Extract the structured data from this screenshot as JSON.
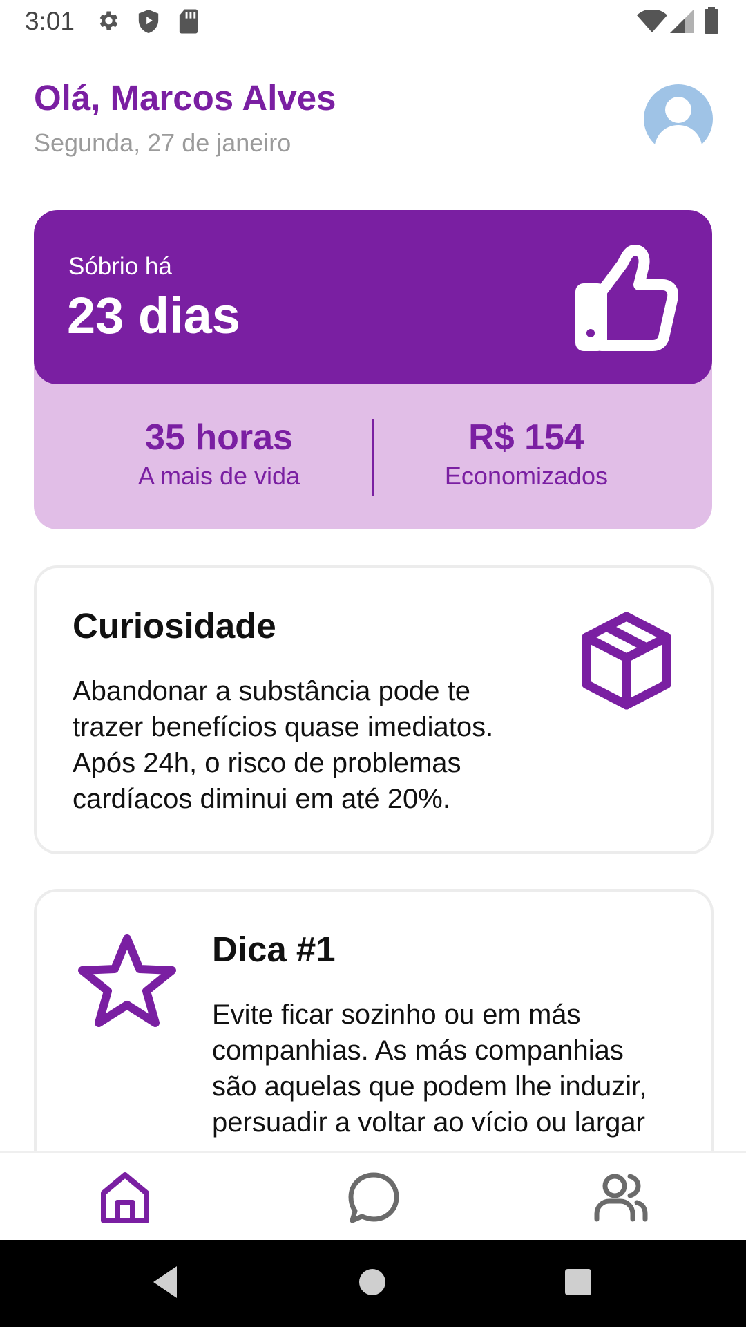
{
  "status_bar": {
    "time": "3:01",
    "icons": [
      "gear-icon",
      "shield-icon",
      "sd-card-icon",
      "wifi-icon",
      "signal-icon",
      "battery-icon"
    ]
  },
  "header": {
    "greeting": "Olá, Marcos Alves",
    "date": "Segunda, 27 de janeiro",
    "avatar_icon": "user-avatar-icon"
  },
  "sober_card": {
    "label": "Sóbrio há",
    "value": "23 dias",
    "icon": "thumbs-up-icon",
    "stats": [
      {
        "value": "35 horas",
        "label": "A mais de vida"
      },
      {
        "value": "R$ 154",
        "label": "Economizados"
      }
    ]
  },
  "curiosity_card": {
    "title": "Curiosidade",
    "lines": [
      "Abandonar a substância pode te",
      "trazer benefícios quase imediatos.",
      "Após 24h, o risco de problemas",
      "cardíacos diminui em até 20%."
    ],
    "icon": "box-icon"
  },
  "tip_card": {
    "title": "Dica #1",
    "lines": [
      "Evite ficar sozinho ou em más",
      "companhias. As más companhias",
      "são aquelas que podem lhe induzir,",
      "persuadir a voltar ao vício ou largar"
    ],
    "icon": "star-icon"
  },
  "bottom_nav": {
    "items": [
      {
        "icon": "home-icon",
        "active": true
      },
      {
        "icon": "chat-icon",
        "active": false
      },
      {
        "icon": "users-icon",
        "active": false
      }
    ]
  },
  "colors": {
    "primary": "#7a1fa2",
    "primary_light": "#e1bee7",
    "muted_text": "#9b9b9b",
    "nav_inactive": "#6b6b6b"
  }
}
